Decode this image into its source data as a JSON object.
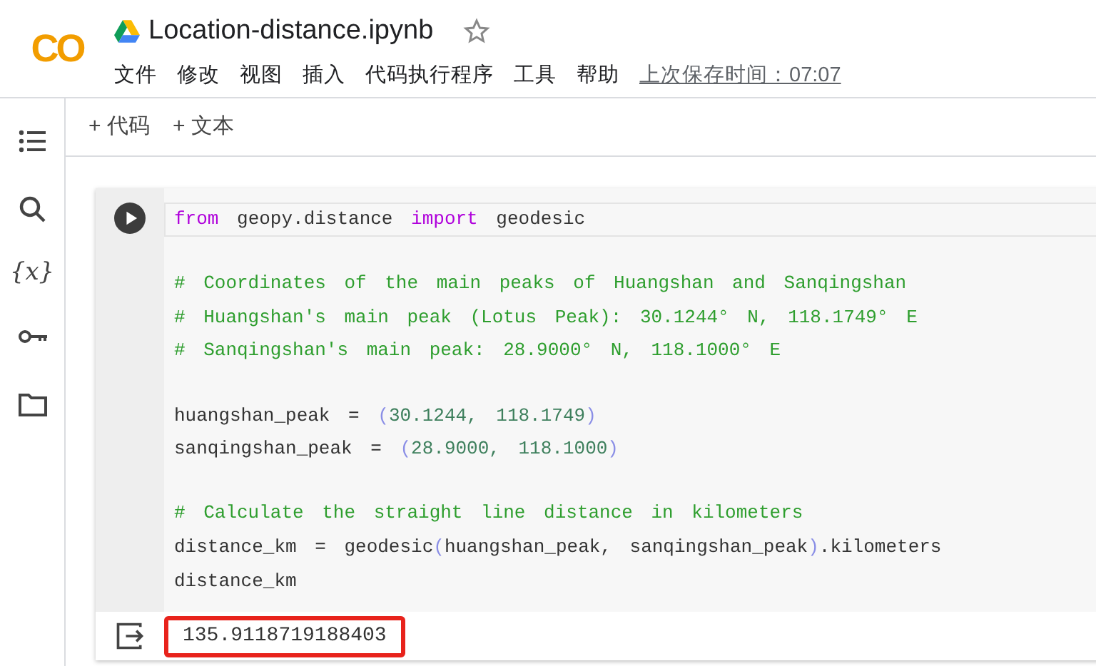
{
  "window": {
    "title": "Location-distance.ipynb",
    "starred": false
  },
  "logo": {
    "text": "CO"
  },
  "menu": [
    {
      "label": "文件"
    },
    {
      "label": "修改"
    },
    {
      "label": "视图"
    },
    {
      "label": "插入"
    },
    {
      "label": "代码执行程序"
    },
    {
      "label": "工具"
    },
    {
      "label": "帮助"
    }
  ],
  "last_saved": "上次保存时间：07:07",
  "sidebar": {
    "items": [
      {
        "kind": "toc"
      },
      {
        "kind": "search"
      },
      {
        "kind": "variables",
        "text": "{x}"
      },
      {
        "kind": "secrets"
      },
      {
        "kind": "files"
      }
    ]
  },
  "toolbar": [
    {
      "label": "+ 代码"
    },
    {
      "label": "+ 文本"
    }
  ],
  "cell": {
    "lines": [
      {
        "kind": "code",
        "tokens": [
          {
            "kind": "keyword",
            "text": "from"
          },
          {
            "kind": "plain",
            "text": " geopy.distance "
          },
          {
            "kind": "keyword",
            "text": "import"
          },
          {
            "kind": "plain",
            "text": " geodesic"
          }
        ]
      },
      {
        "kind": "blank"
      },
      {
        "kind": "code",
        "tokens": [
          {
            "kind": "comment",
            "text": "# Coordinates of the main peaks of Huangshan and Sanqingshan"
          }
        ]
      },
      {
        "kind": "code",
        "tokens": [
          {
            "kind": "comment",
            "text": "# Huangshan's main peak (Lotus Peak): 30.1244° N, 118.1749° E"
          }
        ]
      },
      {
        "kind": "code",
        "tokens": [
          {
            "kind": "comment",
            "text": "# Sanqingshan's main peak: 28.9000° N, 118.1000° E"
          }
        ]
      },
      {
        "kind": "blank"
      },
      {
        "kind": "code",
        "tokens": [
          {
            "kind": "plain",
            "text": "huangshan_peak = "
          },
          {
            "kind": "paren",
            "text": "("
          },
          {
            "kind": "number",
            "text": "30.1244, 118.1749"
          },
          {
            "kind": "paren",
            "text": ")"
          }
        ]
      },
      {
        "kind": "code",
        "tokens": [
          {
            "kind": "plain",
            "text": "sanqingshan_peak = "
          },
          {
            "kind": "paren",
            "text": "("
          },
          {
            "kind": "number",
            "text": "28.9000, 118.1000"
          },
          {
            "kind": "paren",
            "text": ")"
          }
        ]
      },
      {
        "kind": "blank"
      },
      {
        "kind": "code",
        "tokens": [
          {
            "kind": "comment",
            "text": "# Calculate the straight line distance in kilometers"
          }
        ]
      },
      {
        "kind": "code",
        "tokens": [
          {
            "kind": "plain",
            "text": "distance_km = geodesic"
          },
          {
            "kind": "paren",
            "text": "("
          },
          {
            "kind": "plain",
            "text": "huangshan_peak, sanqingshan_peak"
          },
          {
            "kind": "paren",
            "text": ")"
          },
          {
            "kind": "plain",
            "text": ".kilometers"
          }
        ]
      },
      {
        "kind": "code",
        "tokens": [
          {
            "kind": "plain",
            "text": "distance_km"
          }
        ]
      }
    ],
    "output": {
      "text": "135.9118719188403",
      "highlighted": true
    }
  }
}
